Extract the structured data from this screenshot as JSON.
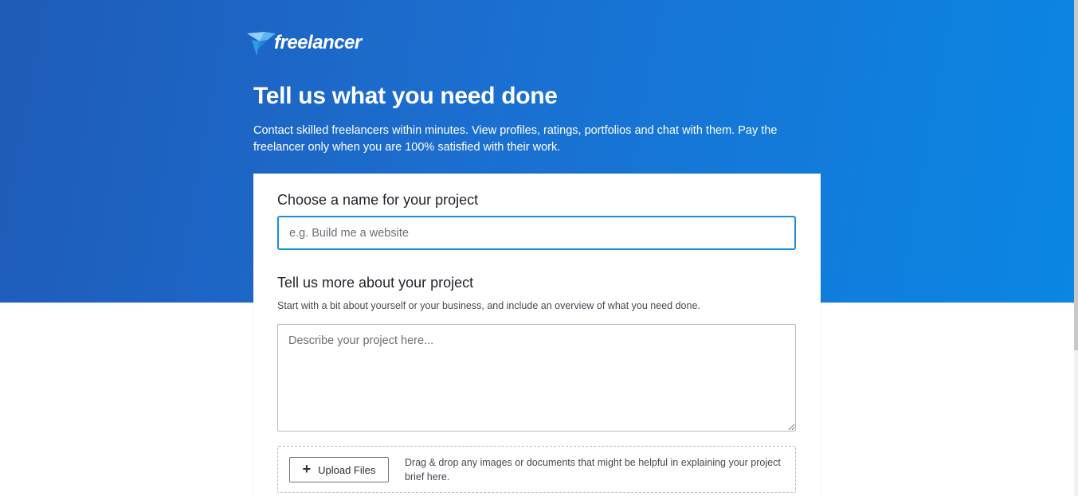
{
  "brand": {
    "name": "freelancer",
    "colors": {
      "hero_start": "#1f5bb8",
      "hero_end": "#0a86e3",
      "input_focus": "#1b8fd6"
    }
  },
  "hero": {
    "title": "Tell us what you need done",
    "subtitle": "Contact skilled freelancers within minutes. View profiles, ratings, portfolios and chat with them. Pay the freelancer only when you are 100% satisfied with their work."
  },
  "form": {
    "name_section": {
      "label": "Choose a name for your project",
      "input_value": "",
      "placeholder": "e.g. Build me a website"
    },
    "description_section": {
      "label": "Tell us more about your project",
      "hint": "Start with a bit about yourself or your business, and include an overview of what you need done.",
      "textarea_value": "",
      "placeholder": "Describe your project here..."
    },
    "upload": {
      "icon": "plus-icon",
      "button_label": "Upload Files",
      "help_text": "Drag & drop any images or documents that might be helpful in explaining your project brief here."
    }
  }
}
